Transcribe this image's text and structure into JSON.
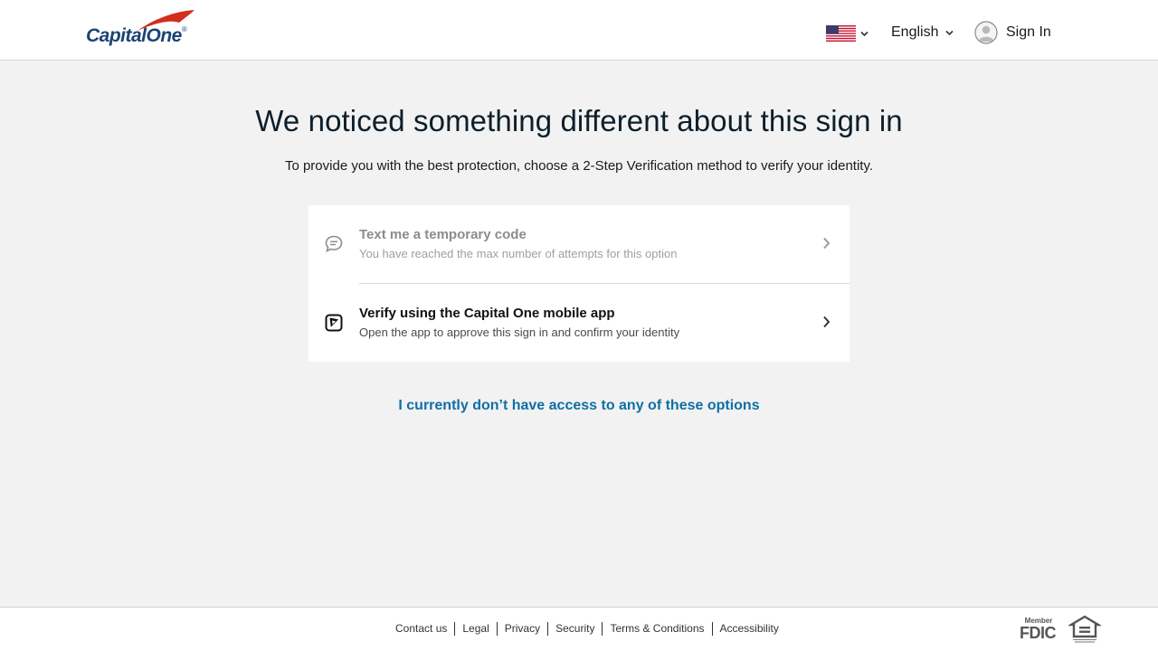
{
  "header": {
    "logo_text": "CapitalOne",
    "logo_reg": "®",
    "locale_flag": "flag-us-icon",
    "language": "English",
    "sign_in": "Sign In"
  },
  "main": {
    "title": "We noticed something different about this sign in",
    "subtitle": "To provide you with the best protection, choose a 2-Step Verification method to verify your identity.",
    "options": [
      {
        "title": "Text me a temporary code",
        "description": "You have reached the max number of attempts for this option",
        "icon": "chat-bubble-icon",
        "disabled": true
      },
      {
        "title": "Verify using the Capital One mobile app",
        "description": "Open the app to approve this sign in and confirm your identity",
        "icon": "mobile-app-icon",
        "disabled": false
      }
    ],
    "no_access_link": "I currently don’t have access to any of these options"
  },
  "footer": {
    "links": [
      "Contact us",
      "Legal",
      "Privacy",
      "Security",
      "Terms & Conditions",
      "Accessibility"
    ],
    "fdic_member": "Member",
    "fdic": "FDIC"
  },
  "colors": {
    "brand_navy": "#1b4473",
    "brand_red": "#d22e1e",
    "link_blue": "#0f6fa5",
    "background": "#f2f2f2"
  }
}
